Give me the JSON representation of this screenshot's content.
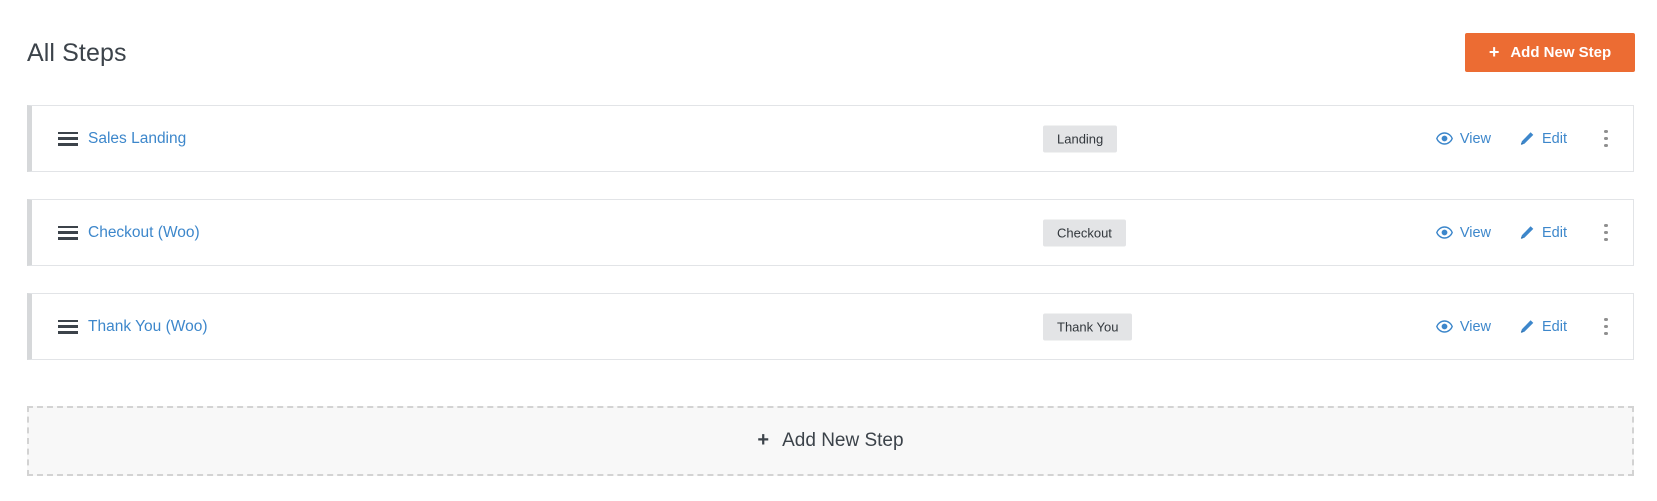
{
  "header": {
    "title": "All Steps",
    "add_button": {
      "label": "Add New Step",
      "icon": "plus-icon",
      "glyph": "+",
      "color": "#ec6c33"
    }
  },
  "steps": {
    "badge_color": "#e3e4e6",
    "link_color": "#3d87cb",
    "items": [
      {
        "name": "Sales Landing",
        "badge": "Landing",
        "drag_icon": "drag-handle-icon",
        "view": {
          "label": "View",
          "icon": "eye-icon"
        },
        "edit": {
          "label": "Edit",
          "icon": "pencil-icon"
        },
        "more": {
          "icon": "kebab-menu-icon"
        }
      },
      {
        "name": "Checkout (Woo)",
        "badge": "Checkout",
        "drag_icon": "drag-handle-icon",
        "view": {
          "label": "View",
          "icon": "eye-icon"
        },
        "edit": {
          "label": "Edit",
          "icon": "pencil-icon"
        },
        "more": {
          "icon": "kebab-menu-icon"
        }
      },
      {
        "name": "Thank You (Woo)",
        "badge": "Thank You",
        "drag_icon": "drag-handle-icon",
        "view": {
          "label": "View",
          "icon": "eye-icon"
        },
        "edit": {
          "label": "Edit",
          "icon": "pencil-icon"
        },
        "more": {
          "icon": "kebab-menu-icon"
        }
      }
    ]
  },
  "add_step_placeholder": {
    "label": "Add New Step",
    "icon": "plus-icon",
    "glyph": "+"
  }
}
